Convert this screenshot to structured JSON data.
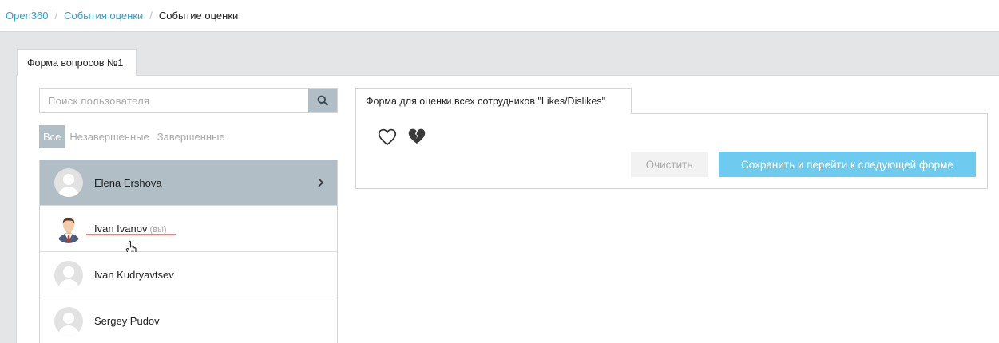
{
  "breadcrumb": {
    "items": [
      "Open360",
      "События оценки"
    ],
    "separator": "/",
    "current": "Событие оценки"
  },
  "outer_tab": {
    "label": "Форма вопросов №1"
  },
  "search": {
    "placeholder": "Поиск пользователя",
    "value": "",
    "icon": "search-icon"
  },
  "filters": [
    {
      "label": "Все",
      "active": true
    },
    {
      "label": "Незавершенные",
      "active": false
    },
    {
      "label": "Завершенные",
      "active": false
    }
  ],
  "users": [
    {
      "name": "Elena Ershova",
      "selected": true
    },
    {
      "name": "Ivan Ivanov",
      "suffix": "(вы)",
      "hovered": true
    },
    {
      "name": "Ivan Kudryavtsev"
    },
    {
      "name": "Sergey Pudov"
    }
  ],
  "form": {
    "tab_label": "Форма для оценки всех сотрудников \"Likes/Dislikes\"",
    "icons": [
      "heart-outline-icon",
      "broken-heart-icon"
    ],
    "clear_label": "Очистить",
    "save_label": "Сохранить и перейти к следующей форме"
  },
  "colors": {
    "link": "#2a9fd6",
    "selected_row": "#b1bec6",
    "primary_button": "#6ccbee",
    "hover_underline": "#f08080"
  }
}
